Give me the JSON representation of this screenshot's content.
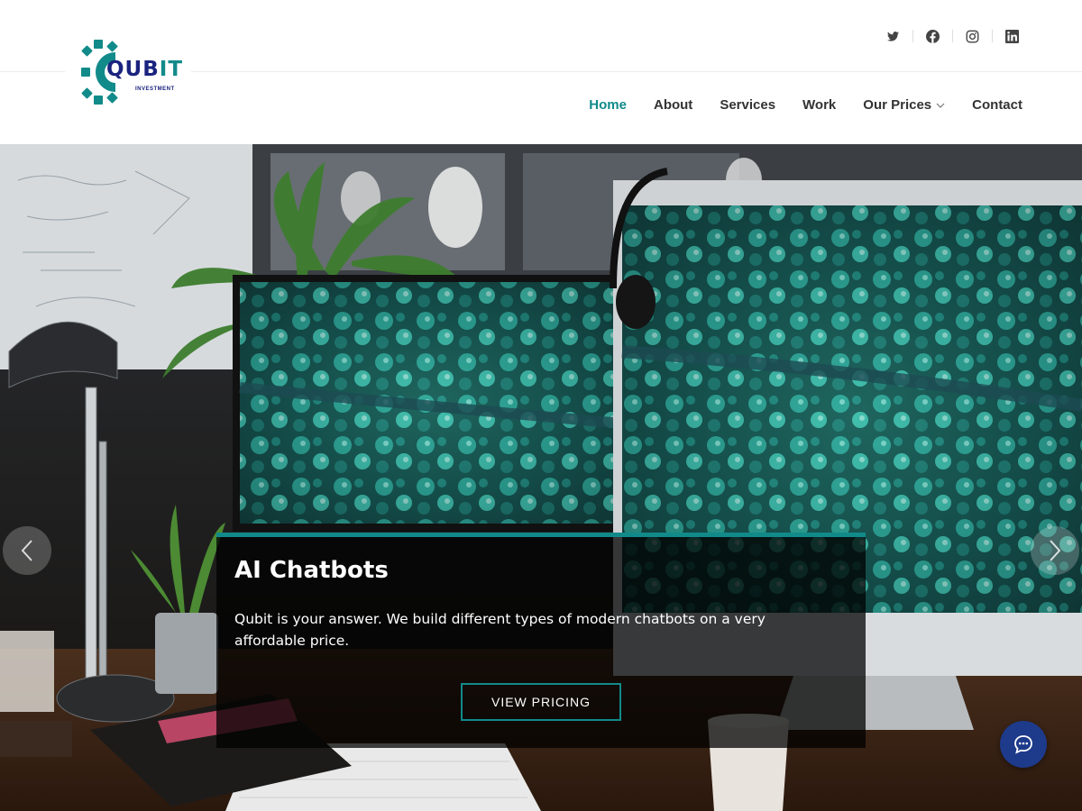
{
  "brand": {
    "name_part1": "QUB",
    "name_part2": "IT",
    "tagline": "INVESTMENT",
    "colors": {
      "primary": "#1a237e",
      "accent": "#118a8a"
    }
  },
  "social": [
    {
      "icon": "twitter-icon"
    },
    {
      "icon": "facebook-icon"
    },
    {
      "icon": "instagram-icon"
    },
    {
      "icon": "linkedin-icon"
    }
  ],
  "nav": {
    "items": [
      {
        "label": "Home",
        "active": true
      },
      {
        "label": "About"
      },
      {
        "label": "Services"
      },
      {
        "label": "Work"
      },
      {
        "label": "Our Prices",
        "has_dropdown": true
      },
      {
        "label": "Contact"
      }
    ]
  },
  "hero": {
    "title": "AI Chatbots",
    "text": "Qubit is your answer. We build different types of modern chatbots on a very affordable price.",
    "button_label": "VIEW PRICING",
    "prev_icon": "chevron-left-icon",
    "next_icon": "chevron-right-icon"
  },
  "chat_widget": {
    "icon": "chat-bubble-icon",
    "color": "#1e3a8a"
  }
}
